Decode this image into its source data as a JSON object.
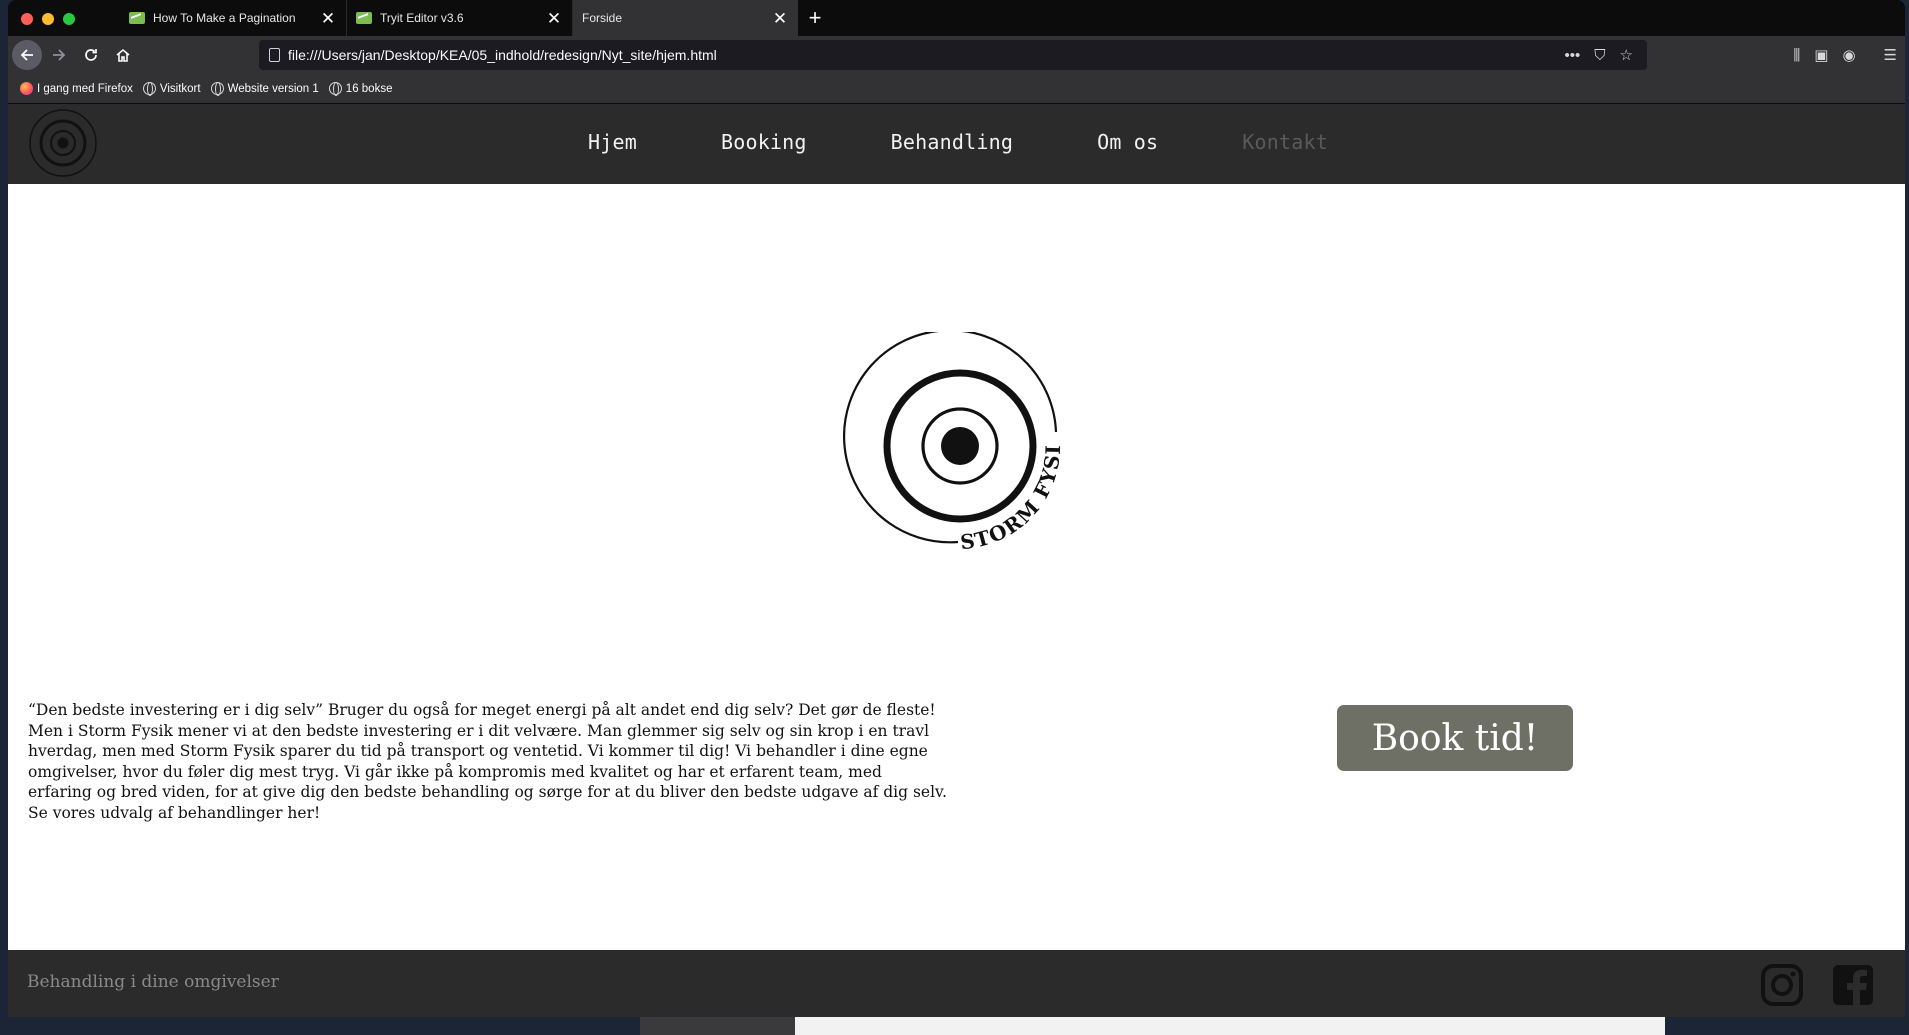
{
  "browser": {
    "tabs": [
      {
        "title": "How To Make a Pagination",
        "active": false
      },
      {
        "title": "Tryit Editor v3.6",
        "active": false
      },
      {
        "title": "Forside",
        "active": true
      }
    ],
    "url": "file:///Users/jan/Desktop/KEA/05_indhold/redesign/Nyt_site/hjem.html",
    "bookmarks": [
      "I gang med Firefox",
      "Visitkort",
      "Website version 1",
      "16 bokse"
    ]
  },
  "site": {
    "nav": [
      {
        "label": "Hjem",
        "active": true
      },
      {
        "label": "Booking",
        "active": true
      },
      {
        "label": "Behandling",
        "active": true
      },
      {
        "label": "Om os",
        "active": true
      },
      {
        "label": "Kontakt",
        "active": false
      }
    ],
    "brand": "STORM FYSIK",
    "intro": "“Den bedste investering er i dig selv” Bruger du også for meget energi på alt andet end dig selv? Det gør de fleste! Men i Storm Fysik mener vi at den bedste investering er i dit velvære. Man glemmer sig selv og sin krop i en travl hverdag, men med Storm Fysik sparer du tid på transport og ventetid. Vi kommer til dig! Vi behandler i dine egne omgivelser, hvor du føler dig mest tryg. Vi går ikke på kompromis med kvalitet og har et erfarent team, med erfaring og bred viden, for at give dig den bedste behandling og sørge for at du bliver den bedste udgave af dig selv. Se vores udvalg af behandlinger her!",
    "book_button": "Book tid!",
    "footer_text": "Behandling i dine omgivelser"
  },
  "colors": {
    "header_bg": "#2b2b2b",
    "button_bg": "#6e7066"
  }
}
